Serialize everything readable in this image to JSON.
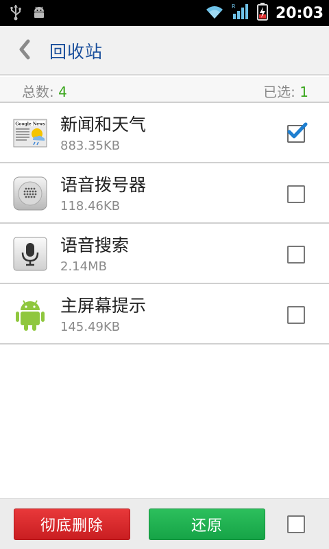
{
  "status_bar": {
    "time": "20:03",
    "icons": [
      "usb-icon",
      "android-debug-icon",
      "wifi-icon",
      "signal-icon",
      "battery-charging-icon"
    ]
  },
  "header": {
    "back_icon": "chevron-left-icon",
    "title": "回收站"
  },
  "summary": {
    "total_label": "总数: ",
    "total_value": "4",
    "selected_label": "已选: ",
    "selected_value": "1"
  },
  "apps": [
    {
      "name": "新闻和天气",
      "size": "883.35KB",
      "icon": "news-weather-icon",
      "checked": true
    },
    {
      "name": "语音拨号器",
      "size": "118.46KB",
      "icon": "voice-dialer-icon",
      "checked": false
    },
    {
      "name": "语音搜索",
      "size": "2.14MB",
      "icon": "voice-search-icon",
      "checked": false
    },
    {
      "name": "主屏幕提示",
      "size": "145.49KB",
      "icon": "android-robot-icon",
      "checked": false
    }
  ],
  "footer": {
    "delete_label": "彻底删除",
    "restore_label": "还原",
    "select_all_checked": false
  },
  "colors": {
    "title": "#1a4f9c",
    "count": "#3aa61d",
    "delete_button": "#d92a2d",
    "restore_button": "#1fb050",
    "checkmark": "#1f7fd0"
  }
}
